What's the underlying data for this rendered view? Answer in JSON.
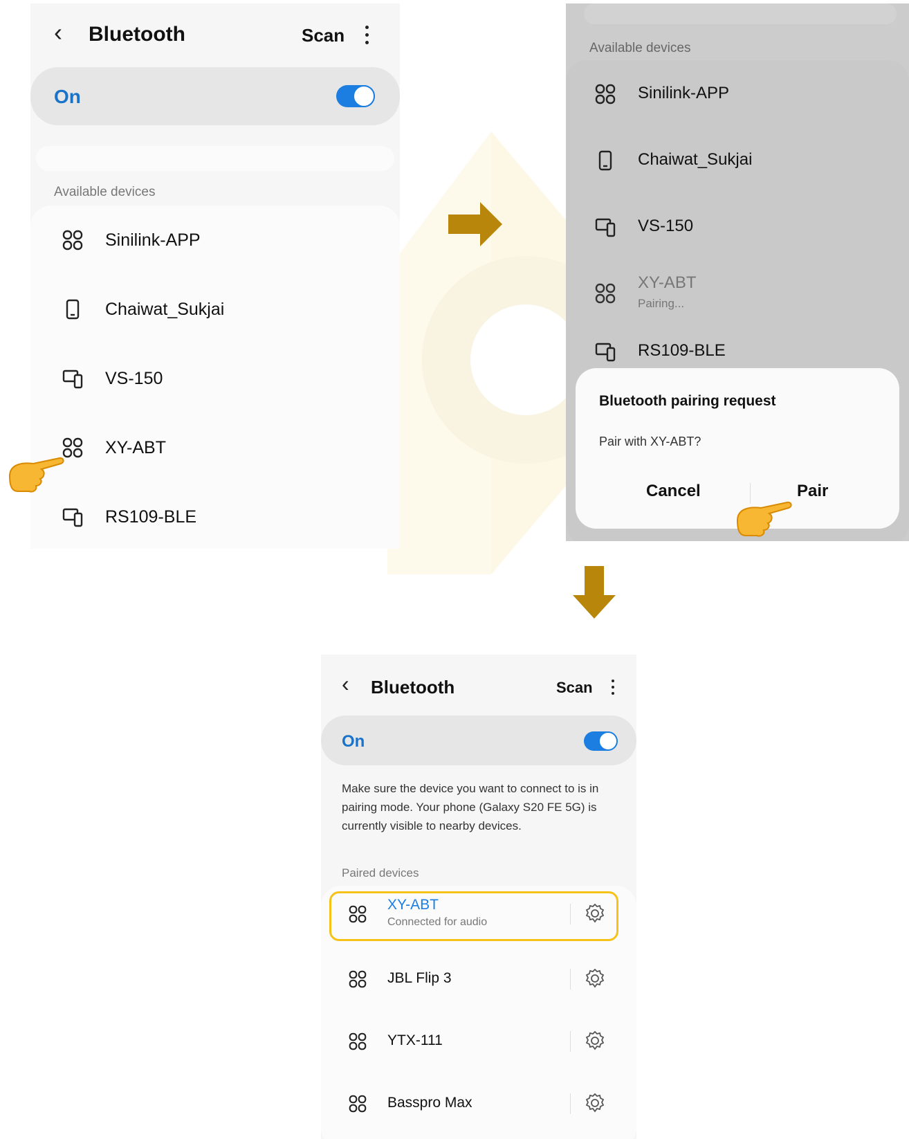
{
  "screens": {
    "s1": {
      "header": {
        "title": "Bluetooth",
        "scan": "Scan"
      },
      "toggle": {
        "label": "On",
        "state": "on"
      },
      "section": "Available devices",
      "devices": [
        {
          "name": "Sinilink-APP",
          "icon": "device-grid-icon"
        },
        {
          "name": "Chaiwat_Sukjai",
          "icon": "phone-icon"
        },
        {
          "name": "VS-150",
          "icon": "multi-device-icon"
        },
        {
          "name": "XY-ABT",
          "icon": "device-grid-icon"
        },
        {
          "name": "RS109-BLE",
          "icon": "multi-device-icon"
        }
      ]
    },
    "s2": {
      "section": "Available devices",
      "devices": [
        {
          "name": "Sinilink-APP",
          "icon": "device-grid-icon"
        },
        {
          "name": "Chaiwat_Sukjai",
          "icon": "phone-icon"
        },
        {
          "name": "VS-150",
          "icon": "multi-device-icon"
        },
        {
          "name": "XY-ABT",
          "sub": "Pairing...",
          "icon": "device-grid-icon"
        },
        {
          "name": "RS109-BLE",
          "icon": "multi-device-icon"
        }
      ],
      "dialog": {
        "title": "Bluetooth pairing request",
        "message": "Pair with XY-ABT?",
        "cancel": "Cancel",
        "pair": "Pair"
      }
    },
    "s3": {
      "header": {
        "title": "Bluetooth",
        "scan": "Scan"
      },
      "toggle": {
        "label": "On",
        "state": "on"
      },
      "info": "Make sure the device you want to connect to is in pairing mode. Your phone (Galaxy S20 FE 5G) is currently visible to nearby devices.",
      "section": "Paired devices",
      "devices": [
        {
          "name": "XY-ABT",
          "sub": "Connected for audio",
          "icon": "device-grid-icon",
          "highlight": true
        },
        {
          "name": "JBL Flip 3",
          "icon": "device-grid-icon"
        },
        {
          "name": "YTX-111",
          "icon": "device-grid-icon"
        },
        {
          "name": "Basspro Max",
          "icon": "device-grid-icon"
        }
      ]
    }
  },
  "colors": {
    "accent": "#1b7ee0",
    "arrow": "#b8860b",
    "highlight": "#f5c21a"
  }
}
